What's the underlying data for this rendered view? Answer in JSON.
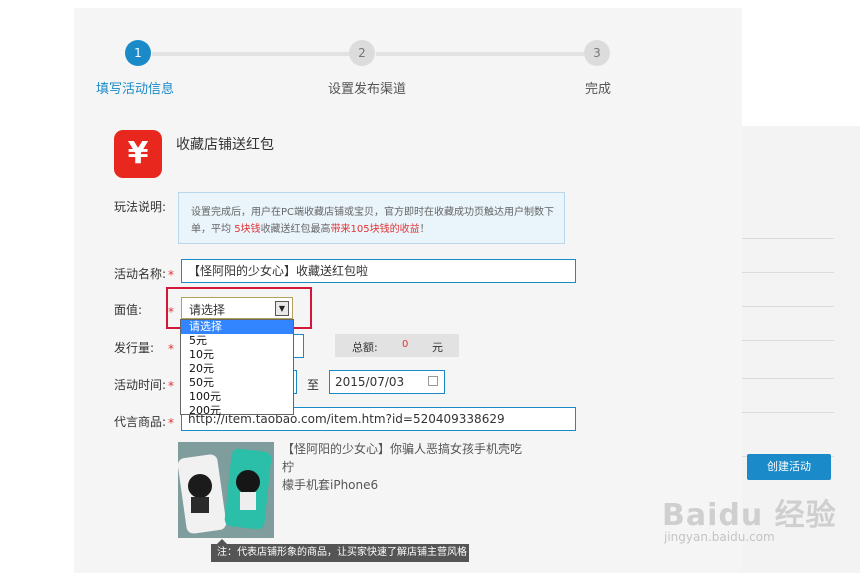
{
  "steps": [
    {
      "num": "1",
      "label": "填写活动信息"
    },
    {
      "num": "2",
      "label": "设置发布渠道"
    },
    {
      "num": "3",
      "label": "完成"
    }
  ],
  "activity": {
    "icon_glyph": "¥",
    "title": "收藏店铺送红包"
  },
  "rules": {
    "label": "玩法说明:",
    "text_1": "设置完成后，用户在PC端收藏店铺或宝贝，官方即时在收藏成功页触达用户制数下",
    "text_2a": "单，平均 ",
    "text_2b": "5块钱",
    "text_2c": "收藏送红包最高",
    "text_2d": "带来105块钱的收益",
    "text_2e": "！"
  },
  "form": {
    "name_label": "活动名称:",
    "name_value": "【怪阿阳的少女心】收藏送红包啦",
    "face_label": "面值:",
    "face_value": "请选择",
    "face_options": [
      "请选择",
      "5元",
      "10元",
      "20元",
      "50元",
      "100元",
      "200元"
    ],
    "qty_label": "发行量:",
    "total_label": "总额:",
    "total_value": "0",
    "total_unit": "元",
    "time_label": "活动时间:",
    "time_to": "至",
    "end_date": "2015/07/03",
    "product_label": "代言商品:",
    "product_url": "http://item.taobao.com/item.htm?id=520409338629",
    "star": "*"
  },
  "product": {
    "title_line1": "【怪阿阳的少女心】你骗人恶搞女孩手机壳吃柠",
    "title_line2": "檬手机套iPhone6",
    "tooltip": "注：代表店铺形象的商品，让买家快速了解店铺主营风格"
  },
  "actions": {
    "create_label": "创建活动"
  },
  "watermark": {
    "main": "Baidu 经验",
    "sub": "jingyan.baidu.com"
  },
  "colors": {
    "accent": "#1a8ac9",
    "highlight": "#d3173b",
    "required": "#e23333",
    "icon_bg": "#e8281e"
  }
}
